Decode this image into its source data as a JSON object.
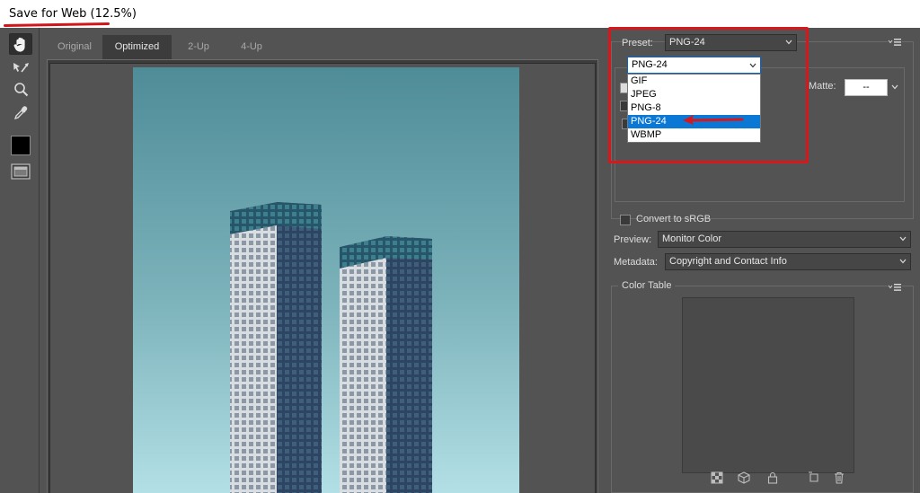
{
  "window": {
    "title": "Save for Web (12.5%)"
  },
  "toolbar": {
    "tools": [
      "hand-tool",
      "slice-select-tool",
      "zoom-tool",
      "eyedropper-tool",
      "eyedropper-color",
      "toggle-slices-visibility"
    ],
    "eyedropper_color": "#000000"
  },
  "tabs": [
    {
      "label": "Original"
    },
    {
      "label": "Optimized"
    },
    {
      "label": "2-Up"
    },
    {
      "label": "4-Up"
    }
  ],
  "settings": {
    "preset_label": "Preset:",
    "preset_value": "PNG-24",
    "format_value": "PNG-24",
    "format_options": [
      "GIF",
      "JPEG",
      "PNG-8",
      "PNG-24",
      "WBMP"
    ],
    "format_selected": "PNG-24",
    "matte_label": "Matte:",
    "matte_value": "--",
    "convert_srgb_label": "Convert to sRGB",
    "preview_label": "Preview:",
    "preview_value": "Monitor Color",
    "metadata_label": "Metadata:",
    "metadata_value": "Copyright and Contact Info"
  },
  "color_table": {
    "title": "Color Table",
    "icons": [
      "web-shift-icon",
      "cube-icon",
      "lock-icon",
      "new-color-icon",
      "trash-icon"
    ]
  },
  "colors": {
    "annotation_red": "#d8171c",
    "selection_blue": "#0a78d4",
    "panel_bg": "#535353"
  }
}
